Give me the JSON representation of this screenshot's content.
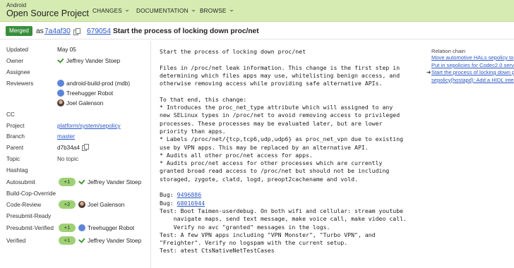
{
  "header": {
    "brand_small": "Android",
    "brand_large": "Open Source Project",
    "nav": [
      "CHANGES",
      "DOCUMENTATION",
      "BROWSE"
    ]
  },
  "titlebar": {
    "status": "Merged",
    "as_label": "as",
    "commit": "7a4af30",
    "change_number": "679054",
    "subject": "Start the process of locking down proc/net"
  },
  "metadata": {
    "updated_label": "Updated",
    "updated_value": "May 05",
    "owner_label": "Owner",
    "owner_value": "Jeffrey Vander Stoep",
    "assignee_label": "Assignee",
    "reviewers_label": "Reviewers",
    "reviewers": [
      "android-build-prod (mdb)",
      "Treehugger Robot",
      "Joel Galenson"
    ],
    "cc_label": "CC",
    "project_label": "Project",
    "project_value": "platform/system/sepolicy",
    "branch_label": "Branch",
    "branch_value": "master",
    "parent_label": "Parent",
    "parent_value": "d7b34a4",
    "topic_label": "Topic",
    "topic_value": "No topic",
    "hashtag_label": "Hashtag",
    "labels": [
      {
        "name": "Autosubmit",
        "vote": "+1",
        "user": "Jeffrey Vander Stoep"
      },
      {
        "name": "Build-Cop-Override"
      },
      {
        "name": "Code-Review",
        "vote": "+2",
        "user": "Joel Galenson"
      },
      {
        "name": "Presubmit-Ready"
      },
      {
        "name": "Presubmit-Verified",
        "vote": "+1",
        "user": "Treehugger Robot"
      },
      {
        "name": "Verified",
        "vote": "+1",
        "user": "Jeffrey Vander Stoep"
      }
    ]
  },
  "commit_message": {
    "subject": "Start the process of locking down proc/net",
    "body": "Files in /proc/net leak information. This change is the first step in\ndetermining which files apps may use, whitelisting benign access, and\notherwise removing access while providing safe alternative APIs.\n\nTo that end, this change:\n* Introduces the proc_net_type attribute which will assigned to any\nnew SELinux types in /proc/net to avoid removing access to privileged\nprocesses. These processes may be evaluated later, but are lower\npriority than apps.\n* Labels /proc/net/{tcp,tcp6,udp,udp6} as proc_net_vpn due to existing\nuse by VPN apps. This may be replaced by an alternative API.\n* Audits all other proc/net access for apps.\n* Audits proc/net access for other processes which are currently\ngranted broad read access to /proc/net but should not be including\nstoraged, zygote, clatd, logd, preopt2cachename and vold.",
    "bug_label": "Bug: ",
    "bugs": [
      "9496886",
      "68016944"
    ],
    "trailer": "Test: Boot Taimen-userdebug. On both wifi and cellular: stream youtube\n    navigate maps, send text message, make voice call, make video call.\n    Verify no avc \"granted\" messages in the logs.\nTest: A few VPN apps including \"VPN Monster\", \"Turbo VPN\", and\n\"Freighter\". Verify no logspam with the current setup.\nTest: atest CtsNativeNetTestCases"
  },
  "relation_chain": {
    "title": "Relation chain",
    "items": [
      "Move automotive HALs sepolicy to",
      "Put in sepolicies for Codec2.0 serv",
      "Start the process of locking down p",
      "sepolicy(hostapd): Add a HIDL inte"
    ],
    "current_index": 2
  }
}
